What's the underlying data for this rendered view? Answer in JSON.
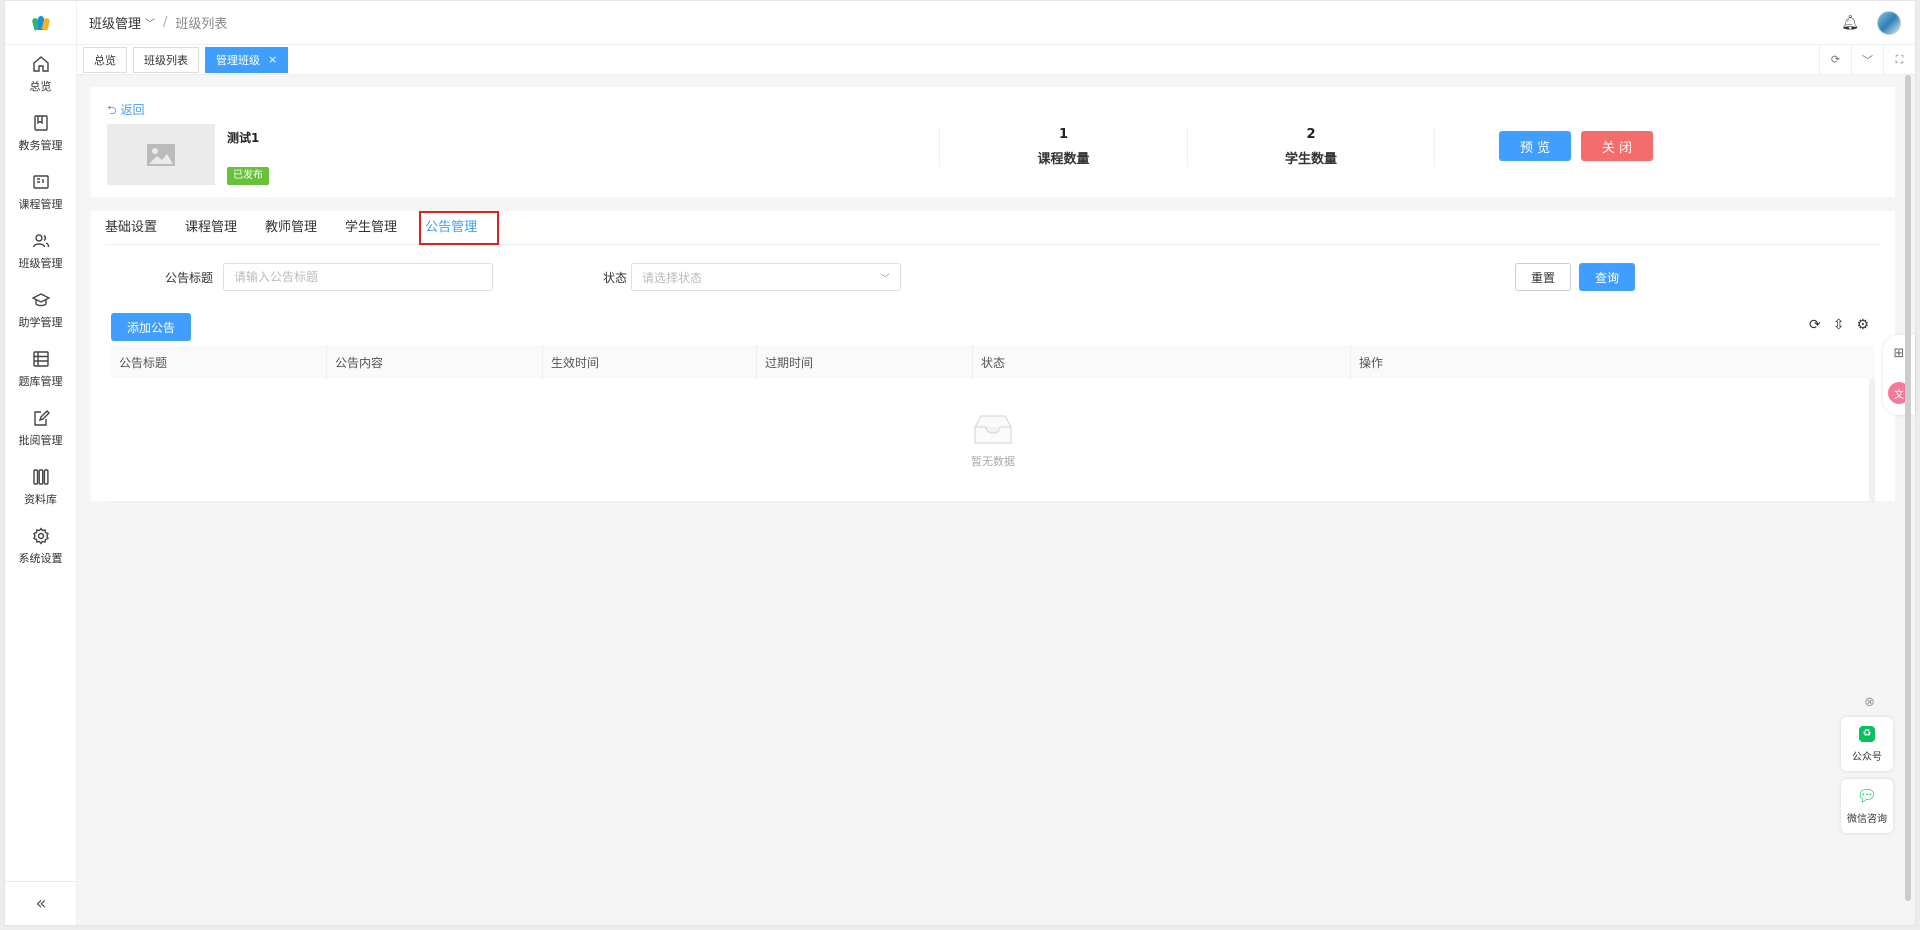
{
  "sidebar": {
    "items": [
      {
        "label": "总览",
        "icon": "home-icon"
      },
      {
        "label": "教务管理",
        "icon": "book-icon"
      },
      {
        "label": "课程管理",
        "icon": "course-icon"
      },
      {
        "label": "班级管理",
        "icon": "users-icon"
      },
      {
        "label": "助学管理",
        "icon": "graduation-icon"
      },
      {
        "label": "题库管理",
        "icon": "database-icon"
      },
      {
        "label": "批阅管理",
        "icon": "edit-icon"
      },
      {
        "label": "资料库",
        "icon": "library-icon"
      },
      {
        "label": "系统设置",
        "icon": "gear-icon"
      }
    ],
    "collapse": "«"
  },
  "header": {
    "crumb1": "班级管理",
    "crumb2": "班级列表"
  },
  "pagetabs": {
    "tab1": "总览",
    "tab2": "班级列表",
    "tab3": "管理班级",
    "close": "×"
  },
  "classinfo": {
    "back": "返回",
    "name": "测试1",
    "status": "已发布",
    "stat1_num": "1",
    "stat1_label": "课程数量",
    "stat2_num": "2",
    "stat2_label": "学生数量",
    "preview_btn": "预 览",
    "close_btn": "关 闭"
  },
  "tabs": {
    "t1": "基础设置",
    "t2": "课程管理",
    "t3": "教师管理",
    "t4": "学生管理",
    "t5": "公告管理"
  },
  "filter": {
    "title_label": "公告标题",
    "title_placeholder": "请输入公告标题",
    "status_label": "状态",
    "status_placeholder": "请选择状态",
    "reset_btn": "重置",
    "query_btn": "查询"
  },
  "add_btn": "添加公告",
  "table": {
    "columns": [
      "公告标题",
      "公告内容",
      "生效时间",
      "过期时间",
      "状态",
      "操作"
    ],
    "empty": "暂无数据"
  },
  "floats": {
    "gzh": "公众号",
    "wechat": "微信咨询"
  },
  "colors": {
    "primary": "#409eff",
    "danger": "#f56c6c",
    "success": "#67c23a",
    "highlight": "#e02020"
  }
}
